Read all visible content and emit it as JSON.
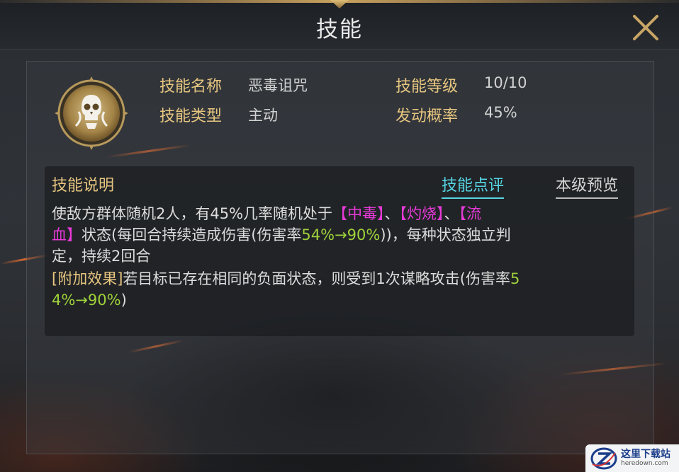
{
  "header": {
    "title": "技能",
    "close_icon": "close-x-icon"
  },
  "skill": {
    "icon": "skull-emblem-icon",
    "name_label": "技能名称",
    "name_value": "恶毒诅咒",
    "level_label": "技能等级",
    "level_value": "10/10",
    "type_label": "技能类型",
    "type_value": "主动",
    "rate_label": "发动概率",
    "rate_value": "45%"
  },
  "description": {
    "title": "技能说明",
    "review_tab": "技能点评",
    "preview_tab": "本级预览",
    "line1_a": "使敌方群体随机2人，有45%几率随机处于",
    "line1_b": "【中毒】",
    "line1_c": "、",
    "line1_d": "【灼烧】",
    "line1_e": "、",
    "line1_f": "【流",
    "line2_a": "血】",
    "line2_b": "状态(每回合持续造成伤害(伤害率",
    "line2_c": "54%→90%",
    "line2_d": "))，每种状态独立判",
    "line3": "定，持续2回合",
    "line4_a": "[附加效果]",
    "line4_b": "若目标已存在相同的负面状态，则受到1次谋略攻击(伤害率",
    "line4_c": "5",
    "line5_a": "4%→90%",
    "line5_b": ")"
  },
  "watermark": {
    "name": "这里下载站",
    "url": "heredown.com"
  },
  "colors": {
    "gold_label": "#e7c680",
    "status_pink": "#e63ad7",
    "value_green": "#9fd23a",
    "link_cyan": "#56d6e3"
  }
}
